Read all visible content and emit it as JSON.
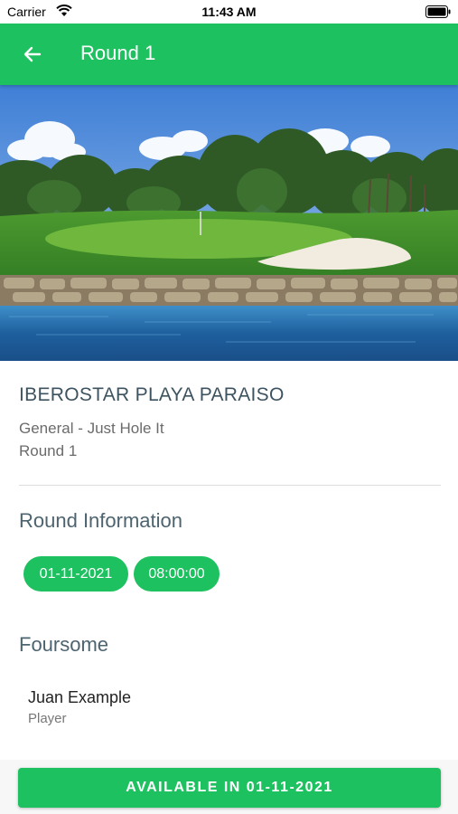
{
  "status_bar": {
    "carrier": "Carrier",
    "time": "11:43 AM"
  },
  "app_bar": {
    "title": "Round 1",
    "back_icon": "arrow-left-icon",
    "color": "#1ec15f"
  },
  "hero": {
    "image": "golf-course-photo"
  },
  "course": {
    "name": "IBEROSTAR PLAYA PARAISO",
    "subtitle": "General - Just Hole It",
    "round": "Round 1"
  },
  "round_info": {
    "title": "Round Information",
    "date": "01-11-2021",
    "time": "08:00:00"
  },
  "foursome": {
    "title": "Foursome",
    "players": [
      {
        "name": "Juan Example",
        "role": "Player"
      }
    ]
  },
  "action": {
    "label": "AVAILABLE IN 01-11-2021"
  }
}
